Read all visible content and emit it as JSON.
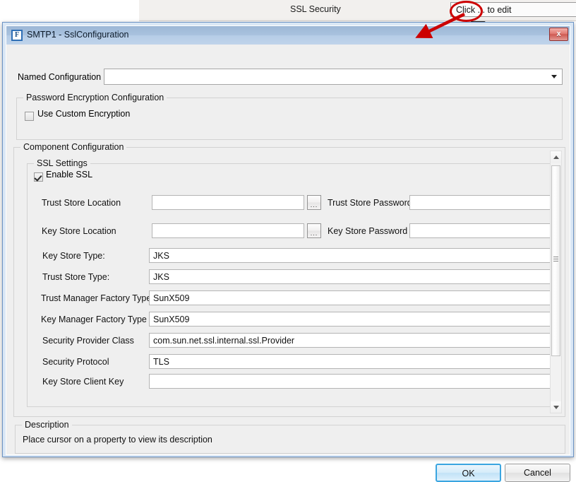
{
  "background_app": {
    "property_label": "SSL Security",
    "property_value": "Click ... to edit",
    "ellipsis_button_label": "...",
    "annotation_color": "#cc0000"
  },
  "dialog": {
    "icon_glyph": "F",
    "title": "SMTP1 - SslConfiguration",
    "close_label": "x",
    "titlebar_color": "#a9c2de",
    "frame_color": "#6c93c4",
    "body_color": "#efefef",
    "named_configuration": {
      "label": "Named Configuration",
      "value": "",
      "placeholder": ""
    },
    "password_group": {
      "title": "Password Encryption Configuration",
      "checkbox_label": "Use Custom Encryption",
      "checked": false
    },
    "component_group": {
      "title": "Component Configuration",
      "ssl_group": {
        "title": "SSL Settings",
        "enable_checkbox_label": "Enable SSL",
        "enable_checked": true,
        "browse_button_label": "...",
        "location_fields": [
          {
            "label": "Trust Store Location",
            "value": "",
            "password_label": "Trust Store Password",
            "password_value": ""
          },
          {
            "label": "Key Store Location",
            "value": "",
            "password_label": "Key Store Password",
            "password_value": ""
          }
        ],
        "text_fields": [
          {
            "label": "Key Store Type:",
            "value": "JKS"
          },
          {
            "label": "Trust Store Type:",
            "value": "JKS"
          },
          {
            "label": "Trust Manager Factory Type",
            "value": "SunX509"
          },
          {
            "label": "Key Manager Factory Type",
            "value": "SunX509"
          },
          {
            "label": "Security Provider Class",
            "value": "com.sun.net.ssl.internal.ssl.Provider"
          },
          {
            "label": "Security Protocol",
            "value": "TLS"
          },
          {
            "label": "Key Store Client Key",
            "value": ""
          }
        ]
      }
    },
    "description_group": {
      "title": "Description",
      "text": "Place cursor on a property to view its description"
    },
    "buttons": {
      "ok": "OK",
      "cancel": "Cancel"
    }
  }
}
